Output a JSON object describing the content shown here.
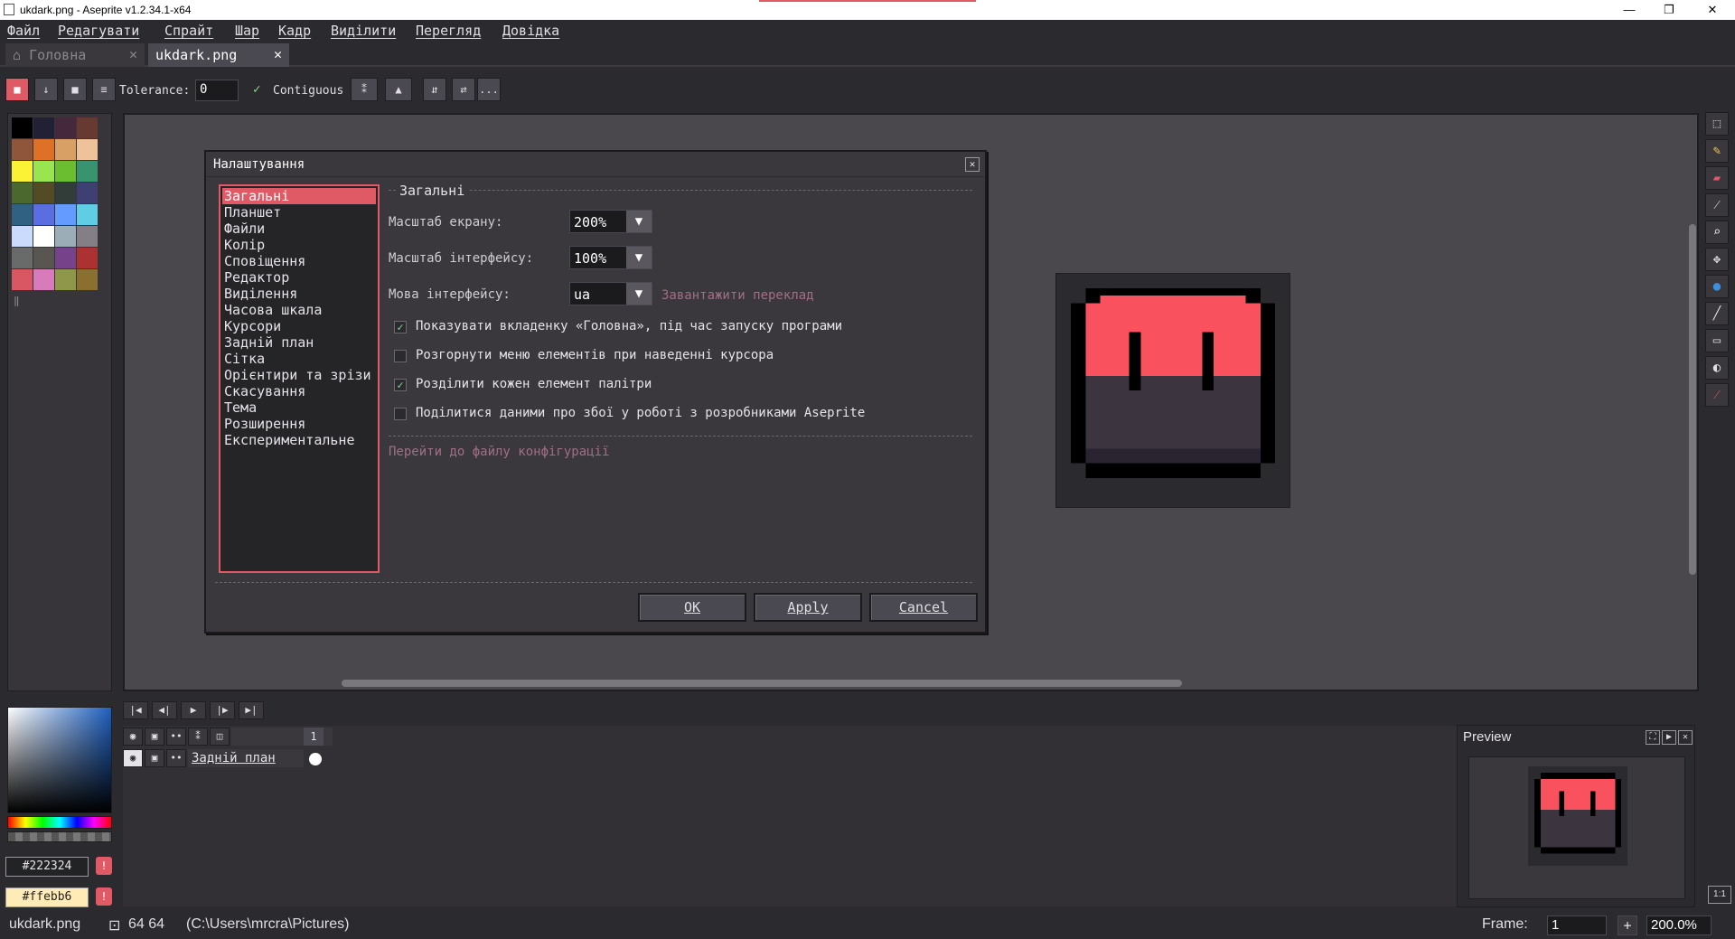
{
  "window": {
    "title": "ukdark.png - Aseprite v1.2.34.1-x64",
    "minimize": "—",
    "restore": "❐",
    "close": "✕"
  },
  "menu": [
    "Файл",
    "Редагувати",
    "Спрайт",
    "Шар",
    "Кадр",
    "Виділити",
    "Перегляд",
    "Довідка"
  ],
  "tabs": {
    "home": "Головна",
    "file": "ukdark.png",
    "close_glyph": "✕"
  },
  "contextbar": {
    "tolerance_label": "Tolerance:",
    "tolerance_value": "0",
    "contiguous_label": "Contiguous",
    "more": "..."
  },
  "palette": {
    "colors": [
      "#000000",
      "#222034",
      "#45283c",
      "#663931",
      "#8f563b",
      "#df7126",
      "#d9a066",
      "#eec39a",
      "#fbf236",
      "#99e550",
      "#6abe30",
      "#37946e",
      "#4b692f",
      "#524b24",
      "#323c39",
      "#3f3f74",
      "#306082",
      "#5b6ee1",
      "#639bff",
      "#5fcde4",
      "#cbdbfc",
      "#ffffff",
      "#9badb7",
      "#847e87",
      "#696a6a",
      "#595652",
      "#76428a",
      "#ac3232",
      "#d95763",
      "#d77bba",
      "#8f974a",
      "#8a6f30"
    ],
    "bg_hex": "#222324",
    "fg_hex": "#ffebb6",
    "warn_glyph": "!"
  },
  "dialog": {
    "title": "Налаштування",
    "close": "✕",
    "categories": [
      "Загальні",
      "Планшет",
      "Файли",
      "Колір",
      "Сповіщення",
      "Редактор",
      "Виділення",
      "Часова шкала",
      "Курсори",
      "Задній план",
      "Сітка",
      "Орієнтири та зрізи",
      "Скасування",
      "Тема",
      "Розширення",
      "Експериментальне"
    ],
    "selected_category": "Загальні",
    "section_title": "Загальні",
    "screen_scale_label": "Масштаб екрану:",
    "screen_scale_value": "200%",
    "ui_scale_label": "Масштаб інтерфейсу:",
    "ui_scale_value": "100%",
    "language_label": "Мова інтерфейсу:",
    "language_value": "ua",
    "download_translation": "Завантажити переклад",
    "options": [
      {
        "label": "Показувати вкладенку «Головна», під час запуску програми",
        "checked": true
      },
      {
        "label": "Розгорнути меню елементів при наведенні курсора",
        "checked": false
      },
      {
        "label": "Розділити кожен елемент палітри",
        "checked": true
      },
      {
        "label": "Поділитися даними про збої у роботі з розробниками Aseprite",
        "checked": false
      }
    ],
    "config_link": "Перейти до файлу конфігурації",
    "ok": "OK",
    "apply": "Apply",
    "cancel": "Cancel",
    "check_glyph": "✓",
    "arrow_glyph": "▼"
  },
  "timeline": {
    "frame_number": "1",
    "layer_name": "Задній план"
  },
  "preview": {
    "title": "Preview"
  },
  "status": {
    "filename": "ukdark.png",
    "size": "64 64",
    "path": "(C:\\Users\\mrcra\\Pictures)",
    "frame_label": "Frame:",
    "frame_value": "1",
    "zoom_value": "200.0%",
    "one_to_one": "1:1"
  },
  "sprite": {
    "top_color": "#f9515e",
    "bottom_color": "#3c3540",
    "outline_color": "#000000",
    "shadow_color": "#2b2a2e"
  }
}
